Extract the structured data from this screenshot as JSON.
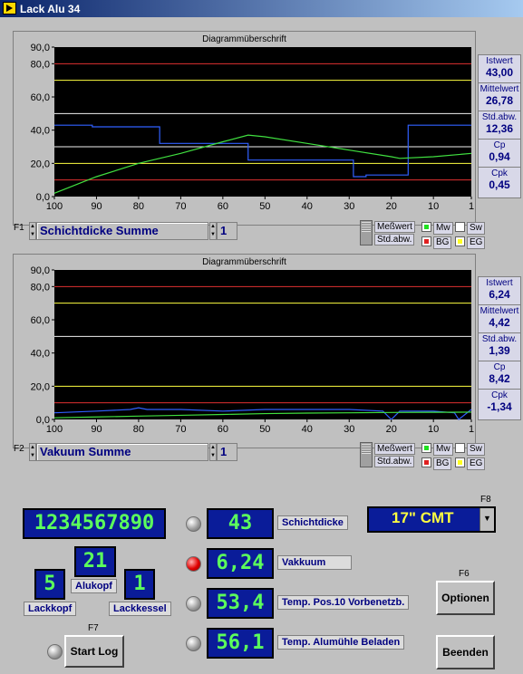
{
  "window": {
    "title": "Lack Alu 34"
  },
  "chart1": {
    "title": "Diagrammüberschrift",
    "fkey": "F1",
    "selector_value": "Schichtdicke Summe",
    "index_value": "1",
    "switch_top": "Meßwert",
    "switch_bottom": "Std.abw.",
    "legend": [
      "Mw",
      "Sw",
      "BG",
      "EG"
    ],
    "stats": [
      {
        "label": "Istwert",
        "value": "43,00"
      },
      {
        "label": "Mittelwert",
        "value": "26,78"
      },
      {
        "label": "Std.abw.",
        "value": "12,36"
      },
      {
        "label": "Cp",
        "value": "0,94"
      },
      {
        "label": "Cpk",
        "value": "0,45"
      }
    ]
  },
  "chart2": {
    "title": "Diagrammüberschrift",
    "fkey": "F2",
    "selector_value": "Vakuum Summe",
    "index_value": "1",
    "switch_top": "Meßwert",
    "switch_bottom": "Std.abw.",
    "legend": [
      "Mw",
      "Sw",
      "BG",
      "EG"
    ],
    "stats": [
      {
        "label": "Istwert",
        "value": "6,24"
      },
      {
        "label": "Mittelwert",
        "value": "4,42"
      },
      {
        "label": "Std.abw.",
        "value": "1,39"
      },
      {
        "label": "Cp",
        "value": "8,42"
      },
      {
        "label": "Cpk",
        "value": "-1,34"
      }
    ]
  },
  "chart_data": [
    {
      "type": "line",
      "title": "Diagrammüberschrift",
      "x_ticks": [
        "100",
        "90",
        "80",
        "70",
        "60",
        "50",
        "40",
        "30",
        "20",
        "10",
        "1"
      ],
      "y_ticks": [
        "90,0",
        "80,0",
        "60,0",
        "40,0",
        "20,0",
        "0,0"
      ],
      "xlim": [
        100,
        1
      ],
      "ylim": [
        0,
        90
      ],
      "background": "#000000",
      "hlines": [
        {
          "y": 80,
          "color": "#e03030"
        },
        {
          "y": 70,
          "color": "#ffff40"
        },
        {
          "y": 50,
          "color": "#f0f0f0"
        },
        {
          "y": 30,
          "color": "#f0f0f0"
        },
        {
          "y": 20,
          "color": "#ffff40"
        },
        {
          "y": 10,
          "color": "#e03030"
        }
      ],
      "series": [
        {
          "color": "#3060ff",
          "step": true,
          "x": [
            100,
            91,
            75,
            58,
            54,
            30,
            29,
            26,
            17,
            16,
            1
          ],
          "y": [
            43,
            42,
            32,
            32,
            22,
            22,
            12,
            13,
            13,
            43,
            43
          ]
        },
        {
          "color": "#40e040",
          "step": false,
          "x": [
            100,
            90,
            80,
            70,
            60,
            54,
            50,
            40,
            30,
            20,
            18,
            10,
            1
          ],
          "y": [
            2,
            12,
            20,
            26,
            33,
            37,
            36,
            32,
            28,
            24,
            23,
            24,
            26
          ]
        }
      ]
    },
    {
      "type": "line",
      "title": "Diagrammüberschrift",
      "x_ticks": [
        "100",
        "90",
        "80",
        "70",
        "60",
        "50",
        "40",
        "30",
        "20",
        "10",
        "1"
      ],
      "y_ticks": [
        "90,0",
        "80,0",
        "60,0",
        "40,0",
        "20,0",
        "0,0"
      ],
      "xlim": [
        100,
        1
      ],
      "ylim": [
        0,
        90
      ],
      "background": "#000000",
      "hlines": [
        {
          "y": 80,
          "color": "#e03030"
        },
        {
          "y": 70,
          "color": "#ffff40"
        },
        {
          "y": 50,
          "color": "#f0f0f0"
        },
        {
          "y": 20,
          "color": "#ffff40"
        },
        {
          "y": 10,
          "color": "#e03030"
        }
      ],
      "series": [
        {
          "color": "#3060ff",
          "step": false,
          "x": [
            100,
            90,
            82,
            80,
            78,
            70,
            60,
            50,
            40,
            30,
            22,
            20,
            18,
            10,
            5,
            4,
            1
          ],
          "y": [
            4,
            5,
            6,
            7,
            6,
            6,
            5,
            6,
            6,
            6,
            5,
            0,
            5,
            5,
            4,
            0,
            6
          ]
        },
        {
          "color": "#40e040",
          "step": false,
          "x": [
            100,
            90,
            80,
            70,
            60,
            50,
            40,
            30,
            20,
            10,
            1
          ],
          "y": [
            1,
            1.5,
            2,
            2.5,
            3,
            3.5,
            3.8,
            4,
            4.2,
            4.3,
            4.4
          ]
        }
      ]
    }
  ],
  "controls": {
    "counter_display": "1234567890",
    "alukopf_value": "21",
    "alukopf_label": "Alukopf",
    "lackkopf_value": "5",
    "lackkopf_label": "Lackkopf",
    "lackkessel_value": "1",
    "lackkessel_label": "Lackkessel",
    "start_log_fkey": "F7",
    "start_log_label": "Start Log",
    "readings": [
      {
        "value": "43",
        "label": "Schichtdicke",
        "led": "off"
      },
      {
        "value": "6,24",
        "label": "Vakkuum",
        "led": "red"
      },
      {
        "value": "53,4",
        "label": "Temp. Pos.10 Vorbenetzb.",
        "led": "off"
      },
      {
        "value": "56,1",
        "label": "Temp. Alumühle Beladen",
        "led": "off"
      }
    ],
    "monitor_fkey": "F8",
    "monitor_value": "17\" CMT",
    "optionen_fkey": "F6",
    "optionen_label": "Optionen",
    "beenden_label": "Beenden"
  }
}
